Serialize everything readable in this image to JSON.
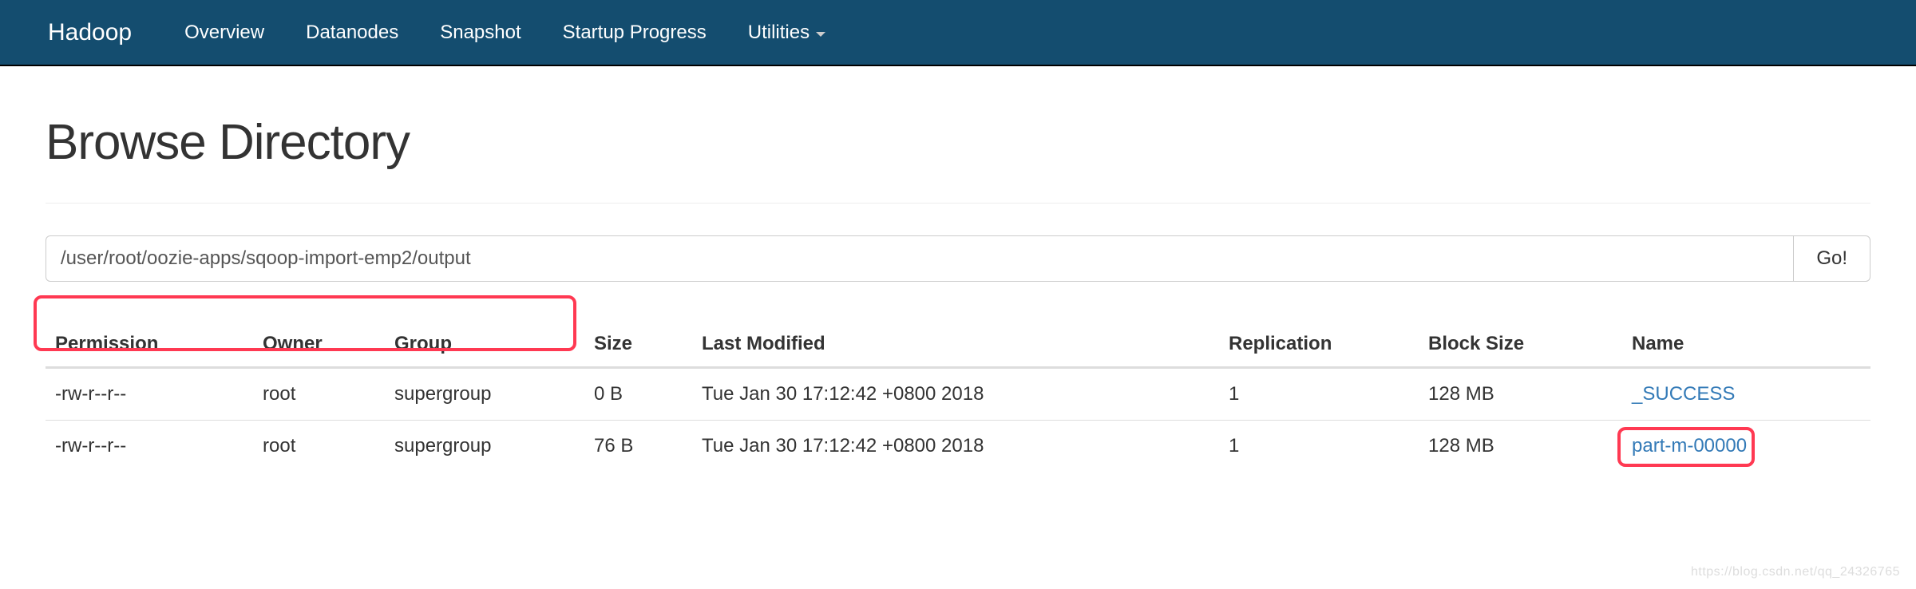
{
  "nav": {
    "brand": "Hadoop",
    "items": [
      "Overview",
      "Datanodes",
      "Snapshot",
      "Startup Progress",
      "Utilities"
    ]
  },
  "page": {
    "title": "Browse Directory",
    "path": "/user/root/oozie-apps/sqoop-import-emp2/output",
    "goButton": "Go!"
  },
  "table": {
    "headers": [
      "Permission",
      "Owner",
      "Group",
      "Size",
      "Last Modified",
      "Replication",
      "Block Size",
      "Name"
    ],
    "rows": [
      {
        "permission": "-rw-r--r--",
        "owner": "root",
        "group": "supergroup",
        "size": "0 B",
        "lastModified": "Tue Jan 30 17:12:42 +0800 2018",
        "replication": "1",
        "blockSize": "128 MB",
        "name": "_SUCCESS",
        "highlighted": false
      },
      {
        "permission": "-rw-r--r--",
        "owner": "root",
        "group": "supergroup",
        "size": "76 B",
        "lastModified": "Tue Jan 30 17:12:42 +0800 2018",
        "replication": "1",
        "blockSize": "128 MB",
        "name": "part-m-00000",
        "highlighted": true
      }
    ]
  },
  "watermark": "https://blog.csdn.net/qq_24326765"
}
